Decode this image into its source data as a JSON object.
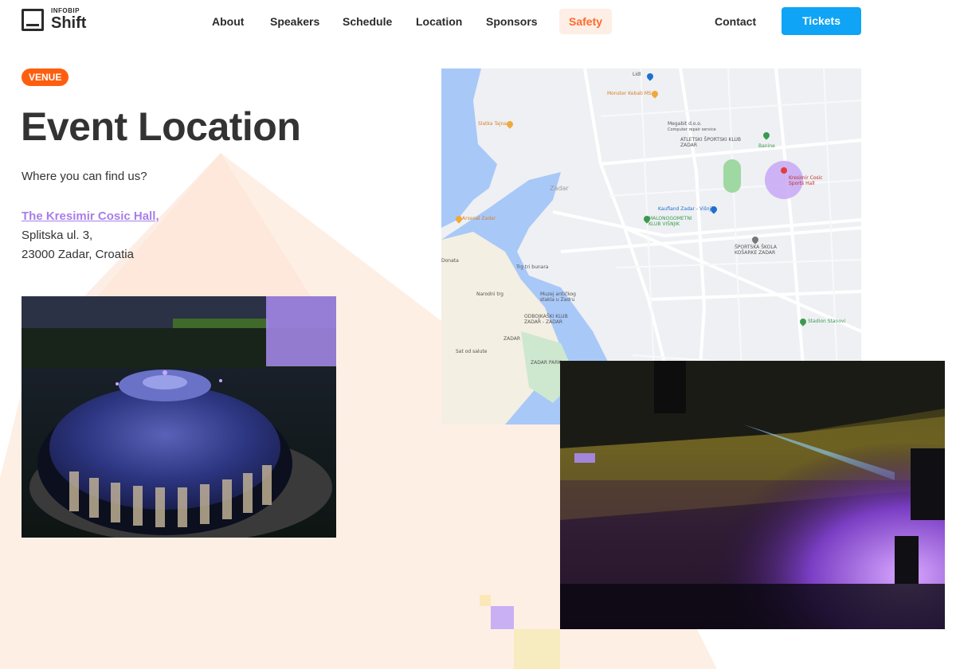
{
  "brand": {
    "top": "INFOBIP",
    "name": "Shift"
  },
  "nav": {
    "about": "About",
    "speakers": "Speakers",
    "schedule": "Schedule",
    "location": "Location",
    "sponsors": "Sponsors",
    "safety": "Safety",
    "contact": "Contact",
    "tickets": "Tickets"
  },
  "section": {
    "badge": "VENUE",
    "title": "Event Location",
    "subtitle": "Where you can find us?",
    "venue_name": "The Kresimir Cosic Hall,",
    "street": "Splitska ul. 3,",
    "city": "23000 Zadar, Croatia"
  },
  "map": {
    "labels": {
      "lidl": "Lidl",
      "monster": "Monster Kebab MS",
      "slatka": "Slatka Tajna",
      "megabit": "Megabit d.o.o.",
      "megabit_sub": "Computer repair service",
      "atletski": "ATLETSKI ŠPORTSKI KLUB ZADAR",
      "banine": "Banine",
      "hall": "Kresimir Cosic Sports Hall",
      "zadar_area": "Zadar",
      "kaufland": "Kaufland Zadar - Višnjik",
      "malonogometni": "MALONOGOMETNI KLUB VIŠNJIK",
      "arsenal": "Arsenal Zadar",
      "skola": "ŠPORTSKA ŠKOLA KOŠARKE ZADAR",
      "tri_bunara": "Trg tri bunara",
      "narodni": "Narodni trg",
      "muzej": "Muzej antičkog stakla u Zadru",
      "odbojkaski": "ODBOJKAŠKI KLUB ZADAR - ZADAR",
      "zadar": "ZADAR",
      "stanovi": "Stadion Stanovi",
      "salute": "Sat od salute",
      "zadar_park": "ZADAR PARK",
      "donata": "Donata"
    }
  },
  "colors": {
    "accent_orange": "#ff5e0e",
    "link_purple": "#a77fe8",
    "tickets_blue": "#0fa4f5"
  }
}
